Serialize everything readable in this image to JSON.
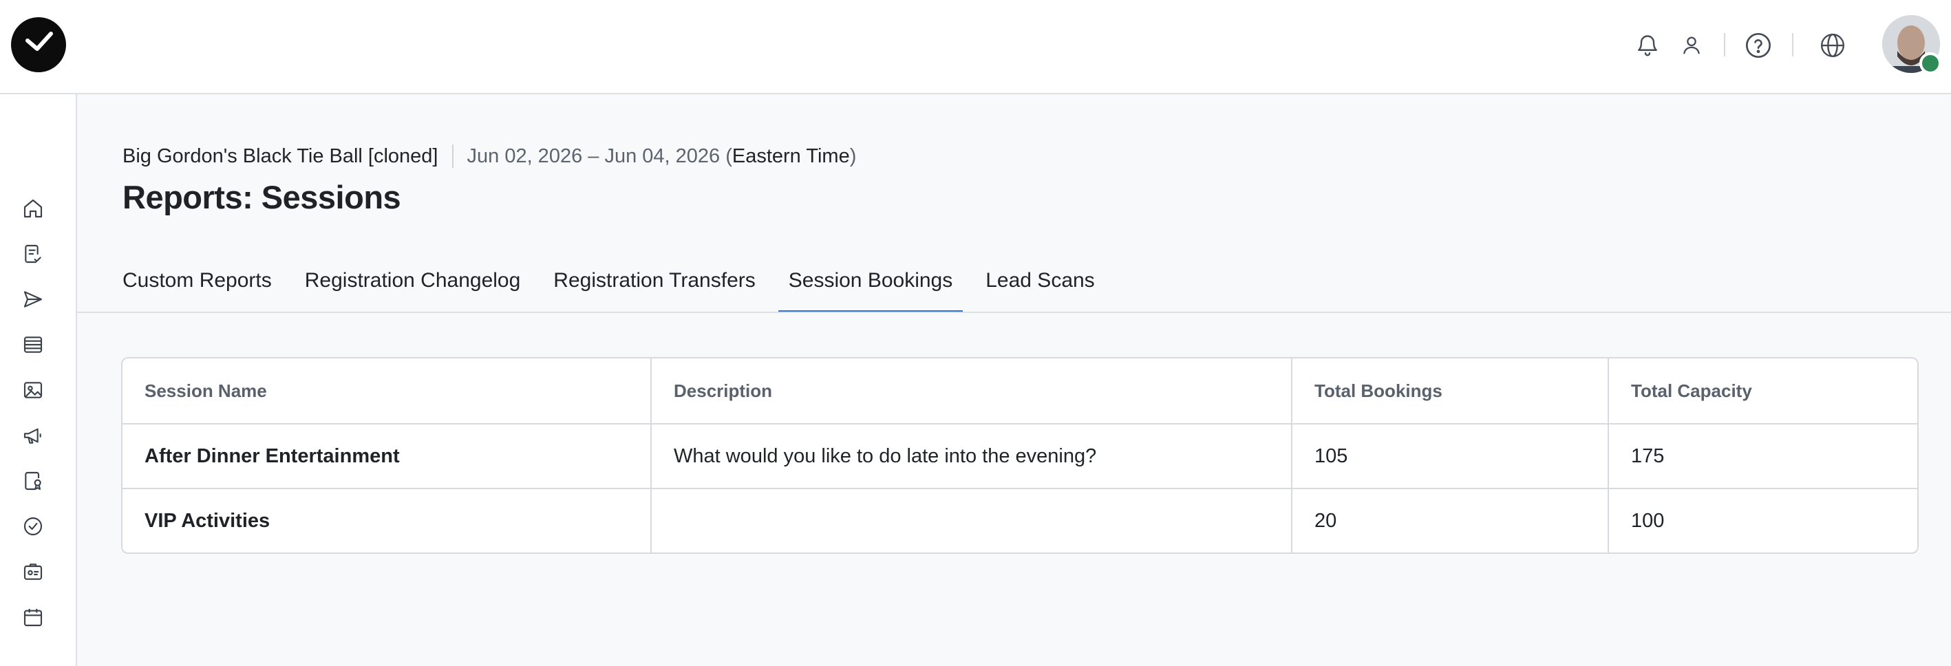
{
  "header": {
    "icons": [
      "bell-icon",
      "user-icon",
      "help-icon",
      "globe-icon"
    ]
  },
  "sidebar": {
    "items": [
      {
        "icon": "home-icon"
      },
      {
        "icon": "checklist-icon"
      },
      {
        "icon": "send-icon"
      },
      {
        "icon": "list-icon"
      },
      {
        "icon": "image-icon"
      },
      {
        "icon": "megaphone-icon"
      },
      {
        "icon": "badge-icon"
      },
      {
        "icon": "check-circle-icon"
      },
      {
        "icon": "id-card-icon"
      },
      {
        "icon": "calendar-icon"
      }
    ]
  },
  "event": {
    "name": "Big Gordon's Black Tie Ball [cloned]",
    "dates_prefix": "Jun 02, 2026 – Jun 04, 2026 (",
    "timezone": "Eastern Time",
    "dates_suffix": ")"
  },
  "page": {
    "title": "Reports: Sessions"
  },
  "tabs": [
    {
      "label": "Custom Reports",
      "active": false
    },
    {
      "label": "Registration Changelog",
      "active": false
    },
    {
      "label": "Registration Transfers",
      "active": false
    },
    {
      "label": "Session Bookings",
      "active": true
    },
    {
      "label": "Lead Scans",
      "active": false
    }
  ],
  "table": {
    "columns": [
      "Session Name",
      "Description",
      "Total Bookings",
      "Total Capacity"
    ],
    "rows": [
      [
        "After Dinner Entertainment",
        "What would you like to do late into the evening?",
        "105",
        "175"
      ],
      [
        "VIP Activities",
        "",
        "20",
        "100"
      ]
    ]
  },
  "colors": {
    "accent": "#2f6fd6",
    "logo": "#0c0c0d",
    "avatar_badge": "#2e8b57"
  }
}
